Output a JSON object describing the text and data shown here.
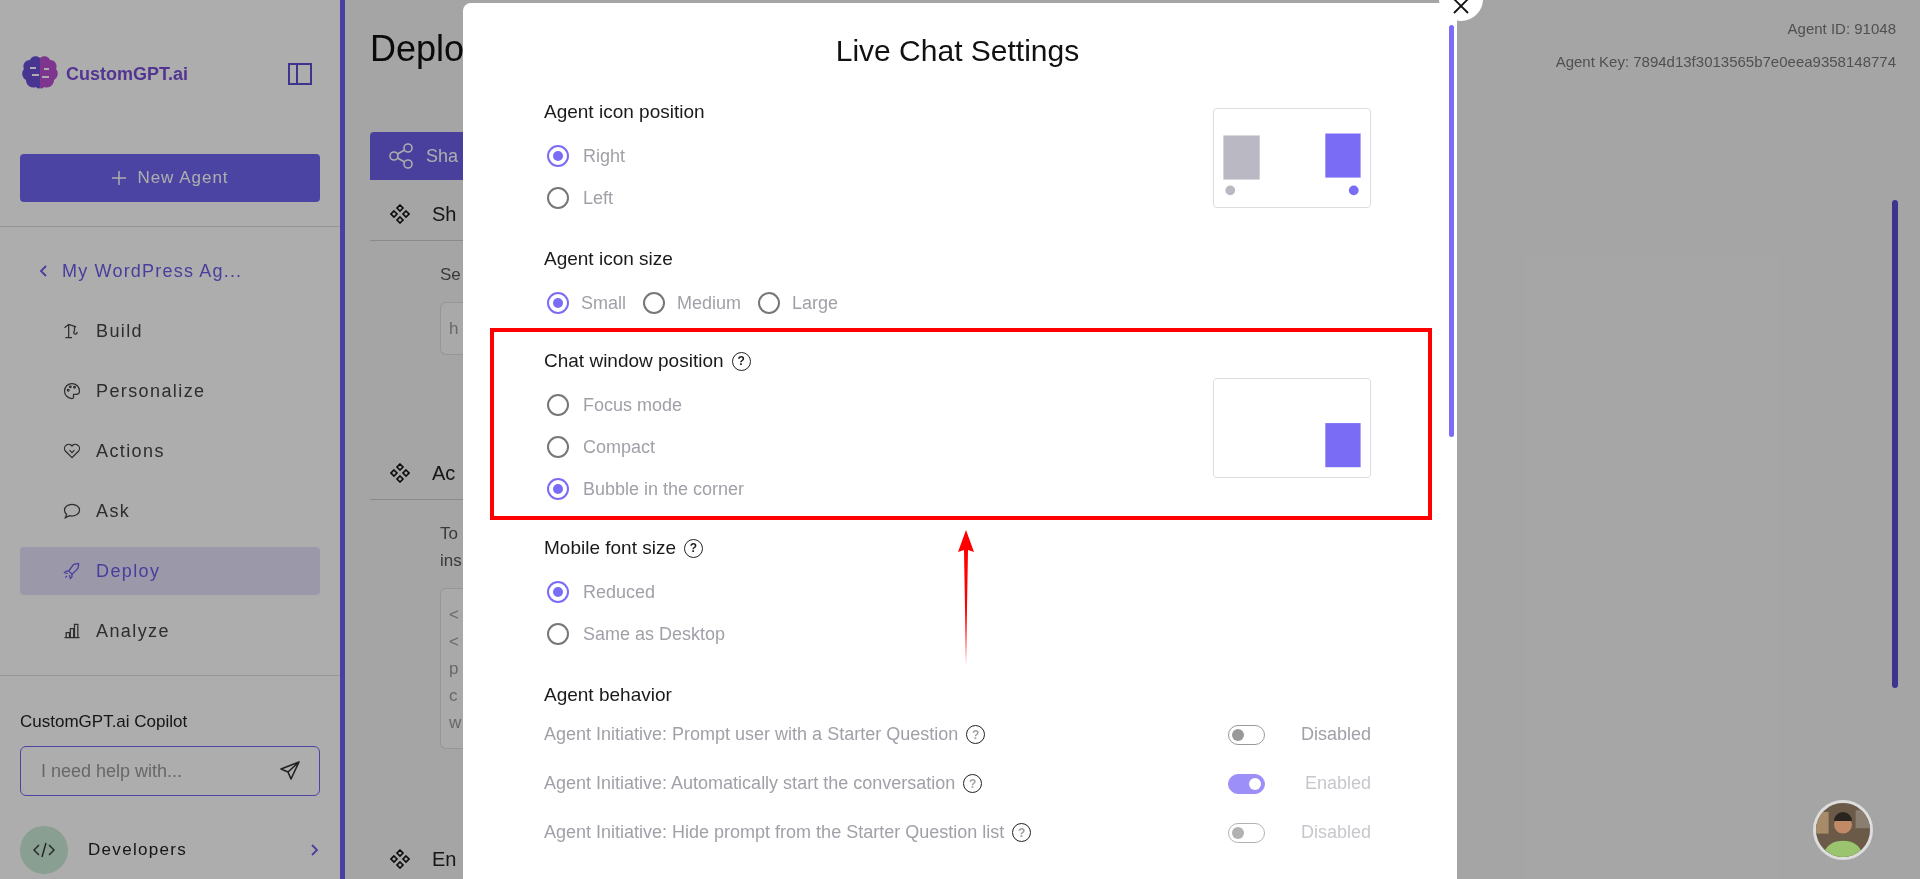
{
  "sidebar": {
    "logo_text": "CustomGPT.ai",
    "new_agent": "New Agent",
    "back_item": "My WordPress Ag...",
    "items": [
      {
        "label": "Build",
        "selected": false
      },
      {
        "label": "Personalize",
        "selected": false
      },
      {
        "label": "Actions",
        "selected": false
      },
      {
        "label": "Ask",
        "selected": false
      },
      {
        "label": "Deploy",
        "selected": true
      },
      {
        "label": "Analyze",
        "selected": false
      }
    ],
    "copilot": {
      "title": "CustomGPT.ai Copilot",
      "placeholder": "I need help with..."
    },
    "developers": "Developers"
  },
  "main": {
    "title": "Deplo",
    "tab": "Sha",
    "sections": [
      {
        "title": "Sh",
        "body": [
          "Se"
        ],
        "field": [
          "h"
        ]
      },
      {
        "title": "Ac",
        "body": [
          "To",
          "ins"
        ],
        "field": [
          "<",
          "<",
          "p",
          "c",
          "w"
        ]
      },
      {
        "title": "En"
      }
    ]
  },
  "header": {
    "agent_id": "Agent ID: 91048",
    "agent_key": "Agent Key: 7894d13f3013565b7e0eea9358148774"
  },
  "modal": {
    "title": "Live Chat Settings",
    "groups": [
      {
        "title": "Agent icon position",
        "kind": "position",
        "highlighted": false,
        "options": [
          {
            "label": "Right",
            "selected": true
          },
          {
            "label": "Left",
            "selected": false
          }
        ]
      },
      {
        "title": "Agent icon size",
        "kind": "inline",
        "highlighted": false,
        "options": [
          {
            "label": "Small",
            "selected": true
          },
          {
            "label": "Medium",
            "selected": false
          },
          {
            "label": "Large",
            "selected": false
          }
        ]
      },
      {
        "title": "Chat window position",
        "help": "?",
        "kind": "window",
        "highlighted": true,
        "options": [
          {
            "label": "Focus mode",
            "selected": false
          },
          {
            "label": "Compact",
            "selected": false
          },
          {
            "label": "Bubble in the corner",
            "selected": true
          }
        ]
      },
      {
        "title": "Mobile font size",
        "help": "?",
        "kind": "stacked",
        "highlighted": false,
        "options": [
          {
            "label": "Reduced",
            "selected": true
          },
          {
            "label": "Same as Desktop",
            "selected": false
          }
        ]
      }
    ],
    "behavior": {
      "title": "Agent behavior",
      "rows": [
        {
          "label": "Agent Initiative: Prompt user with a Starter Question",
          "help": "?",
          "on": false,
          "disabled": false,
          "status": "Disabled"
        },
        {
          "label": "Agent Initiative: Automatically start the conversation",
          "help": "?",
          "on": true,
          "disabled": true,
          "status": "Enabled"
        },
        {
          "label": "Agent Initiative: Hide prompt from the Starter Question list",
          "help": "?",
          "on": false,
          "disabled": true,
          "status": "Disabled"
        }
      ]
    }
  }
}
